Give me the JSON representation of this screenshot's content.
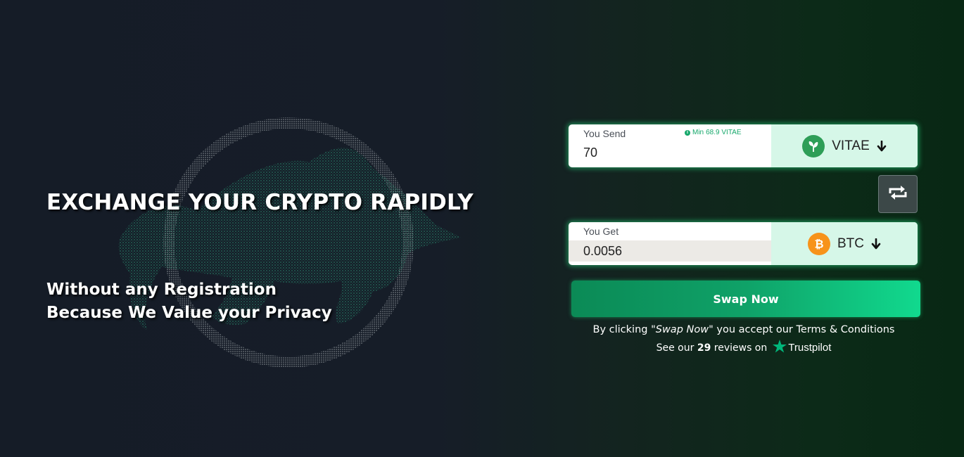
{
  "hero": {
    "title": "EXCHANGE YOUR CRYPTO RAPIDLY",
    "subtitle_line1": "Without any Registration",
    "subtitle_line2": "Because We Value your Privacy"
  },
  "send": {
    "label": "You Send",
    "value": "70",
    "min_label": "Min",
    "min_value": "68.9 VITAE",
    "currency": "VITAE",
    "currency_icon": "vitae-leaf-icon"
  },
  "get": {
    "label": "You Get",
    "value": "0.0056",
    "currency": "BTC",
    "currency_icon": "bitcoin-icon"
  },
  "swap_toggle_icon": "swap-arrows-icon",
  "swap_button": "Swap Now",
  "terms": {
    "prefix": "By clicking ",
    "quoted": "\"Swap Now\"",
    "middle": " you accept our ",
    "link": "Terms & Conditions"
  },
  "reviews": {
    "prefix": "See our",
    "count": "29",
    "suffix": "reviews on",
    "brand": "Trustpilot"
  },
  "colors": {
    "accent_green": "#11d98e",
    "card_currency_bg": "#d6f7e8",
    "vitae_green": "#2e9e57",
    "btc_orange": "#f7931a",
    "trustpilot_star": "#00b67a"
  }
}
